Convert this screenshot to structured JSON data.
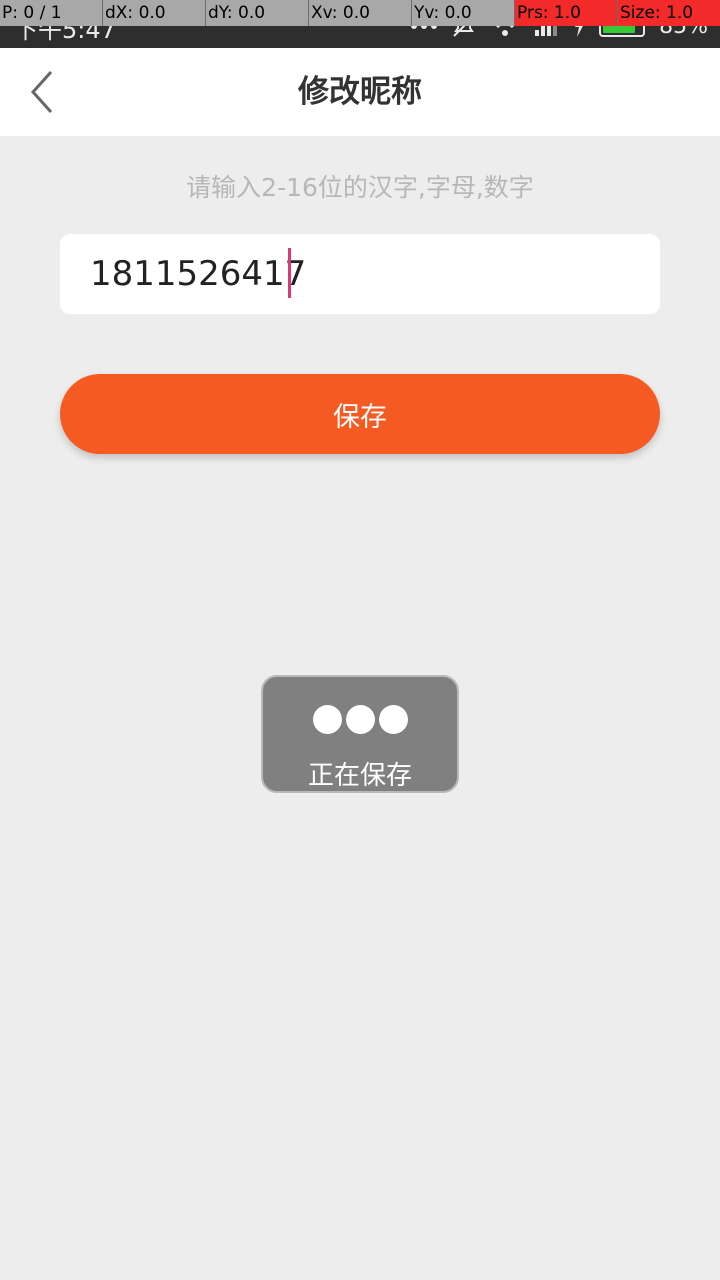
{
  "debug_overlay": {
    "p": "P: 0 / 1",
    "dx": "dX: 0.0",
    "dy": "dY: 0.0",
    "xv": "Xv: 0.0",
    "yv": "Yv: 0.0",
    "prs": "Prs: 1.0",
    "size": "Size: 1.0"
  },
  "status_bar": {
    "time": "下午5:47",
    "battery": "85%",
    "icons": [
      "notification-dots-icon",
      "mute-icon",
      "wifi-icon",
      "signal-icon",
      "charging-icon",
      "battery-icon"
    ]
  },
  "header": {
    "title": "修改昵称",
    "back_icon": "chevron-left-icon"
  },
  "form": {
    "hint": "请输入2-16位的汉字,字母,数字",
    "nickname_value": "1811526417",
    "save_label": "保存"
  },
  "toast": {
    "label": "正在保存"
  },
  "colors": {
    "accent": "#f55a22",
    "background": "#ededed",
    "cursor": "#e0357a",
    "toast": "#808080"
  }
}
